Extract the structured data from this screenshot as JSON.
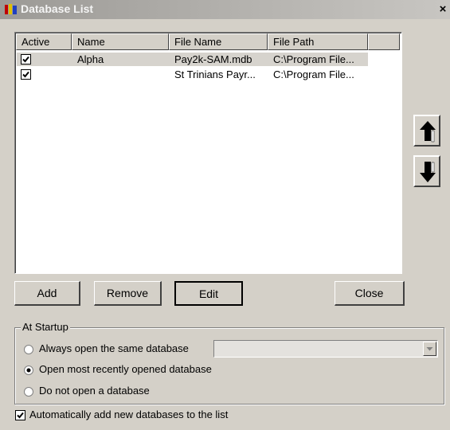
{
  "window": {
    "title": "Database List",
    "close_glyph": "×"
  },
  "list": {
    "columns": [
      "Active",
      "Name",
      "File Name",
      "File Path"
    ],
    "rows": [
      {
        "active": true,
        "name": "Alpha",
        "file_name": "Pay2k-SAM.mdb",
        "file_path": "C:\\Program File..."
      },
      {
        "active": true,
        "name": "",
        "file_name": "St Trinians Payr...",
        "file_path": "C:\\Program File..."
      }
    ]
  },
  "side_buttons": {
    "up_icon": "arrow-up-icon",
    "down_icon": "arrow-down-icon"
  },
  "buttons": {
    "add": "Add",
    "remove": "Remove",
    "edit": "Edit",
    "close": "Close"
  },
  "startup": {
    "group_label": "At Startup",
    "options": [
      {
        "label": "Always open the same database",
        "selected": false
      },
      {
        "label": "Open most recently opened database",
        "selected": true
      },
      {
        "label": "Do not open a database",
        "selected": false
      }
    ],
    "database_select_value": ""
  },
  "auto_add": {
    "label": "Automatically add new databases to the list",
    "checked": true
  }
}
